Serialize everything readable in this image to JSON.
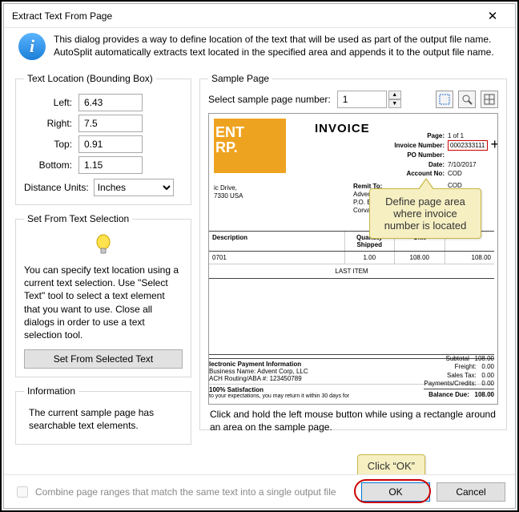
{
  "window": {
    "title": "Extract Text From Page"
  },
  "info": {
    "text": "This dialog provides a way to define location of the text that will be used as part of the output file name. AutoSplit automatically extracts text located in the specified area and appends it to the output file name."
  },
  "location": {
    "legend": "Text Location (Bounding Box)",
    "left_label": "Left:",
    "left_value": "6.43",
    "right_label": "Right:",
    "right_value": "7.5",
    "top_label": "Top:",
    "top_value": "0.91",
    "bottom_label": "Bottom:",
    "bottom_value": "1.15",
    "units_label": "Distance Units:",
    "units_value": "Inches"
  },
  "selection": {
    "legend": "Set From Text Selection",
    "desc": "You can specify text location using a current text selection.  Use \"Select Text\" tool to select a text element that you want to use. Close all dialogs in order to use a text selection tool.",
    "button": "Set From Selected Text"
  },
  "information": {
    "legend": "Information",
    "text": "The current sample page has searchable text elements."
  },
  "sample": {
    "legend": "Sample Page",
    "select_label": "Select sample page number:",
    "page_number": "1",
    "hint": "Click and hold the left mouse button while using a rectangle around an area on the sample page."
  },
  "invoice": {
    "logo_line1": "ENT",
    "logo_line2": "RP.",
    "title": "INVOICE",
    "page_label": "Page:",
    "page_value": "1  of  1",
    "num_label": "Invoice Number:",
    "num_value": "0002333111",
    "po_label": "PO Number:",
    "date_label": "Date:",
    "date_value": "7/10/2017",
    "acct_label": "Account No:",
    "acct_value": "COD",
    "cod": "COD",
    "addr1": "ic Drive,",
    "addr2": "7330 USA",
    "remit_h": "Remit To:",
    "remit_1": "Advent Corp, LLC",
    "remit_2": "P.O. Box 1234",
    "remit_3": "Corvallis, OR, 97330",
    "th_desc": "Description",
    "th_qty": "Quantity Shipped",
    "th_unit": "Unit",
    "code": "0701",
    "qty": "1.00",
    "unit": "108.00",
    "amt": "108.00",
    "last_item": "LAST ITEM",
    "epi": "lectronic Payment Information",
    "biz": "Business Name:  Advent Corp, LLC",
    "ach": "ACH Routing/ABA #:  123450789",
    "sat": "100% Satisfaction",
    "small": "to your expectations, you may return it within 30 days for",
    "sub_l": "Subtotal",
    "sub_v": "108.00",
    "frt_l": "Freight:",
    "frt_v": "0.00",
    "tax_l": "Sales Tax:",
    "tax_v": "0.00",
    "pc_l": "Payments/Credits:",
    "pc_v": "0.00",
    "bal_l": "Balance Due:",
    "bal_v": "108.00"
  },
  "callouts": {
    "define": "Define page area where invoice number is located",
    "clickok": "Click “OK”"
  },
  "footer": {
    "combine": "Combine page ranges that match the same text into a single output file",
    "ok": "OK",
    "cancel": "Cancel"
  }
}
